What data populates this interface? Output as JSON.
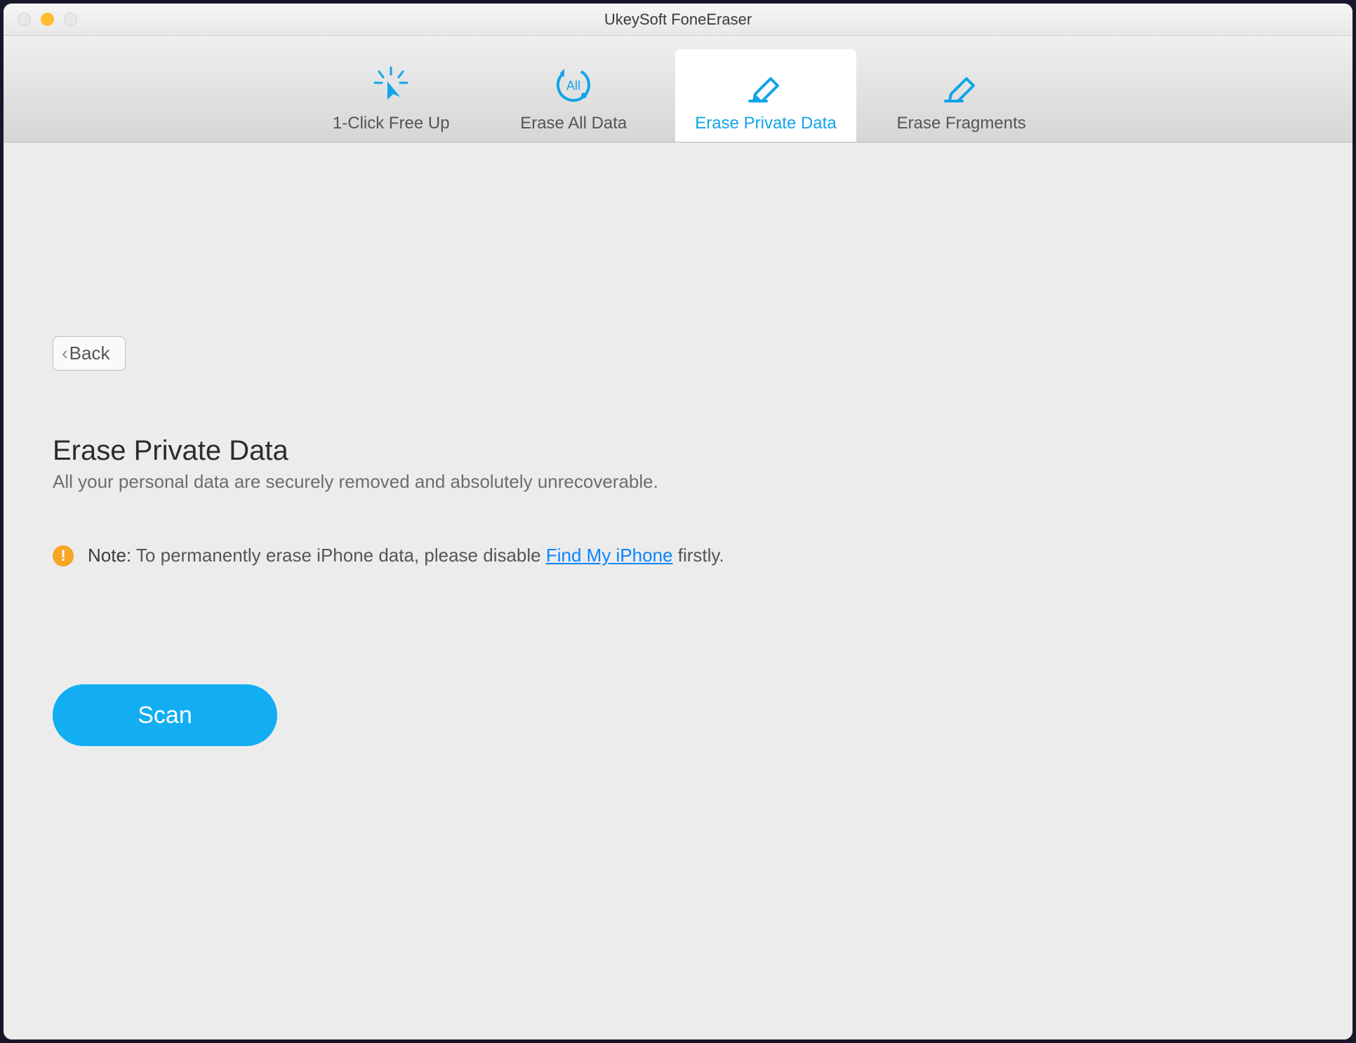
{
  "window": {
    "title": "UkeySoft FoneEraser"
  },
  "tabs": [
    {
      "label": "1-Click Free Up",
      "icon": "click-free-up-icon",
      "active": false
    },
    {
      "label": "Erase All Data",
      "icon": "erase-all-data-icon",
      "active": false
    },
    {
      "label": "Erase Private Data",
      "icon": "erase-private-data-icon",
      "active": true
    },
    {
      "label": "Erase Fragments",
      "icon": "erase-fragments-icon",
      "active": false
    }
  ],
  "back": {
    "label": "Back"
  },
  "page": {
    "title": "Erase Private Data",
    "subtitle": "All your personal data are securely removed and absolutely unrecoverable."
  },
  "note": {
    "label": "Note:",
    "prefix": "To permanently erase iPhone data, please disable ",
    "link": "Find My iPhone",
    "suffix": " firstly."
  },
  "scan": {
    "label": "Scan"
  },
  "colors": {
    "accent": "#13aef2",
    "note_icon": "#f5a623",
    "link": "#0a84ff"
  }
}
